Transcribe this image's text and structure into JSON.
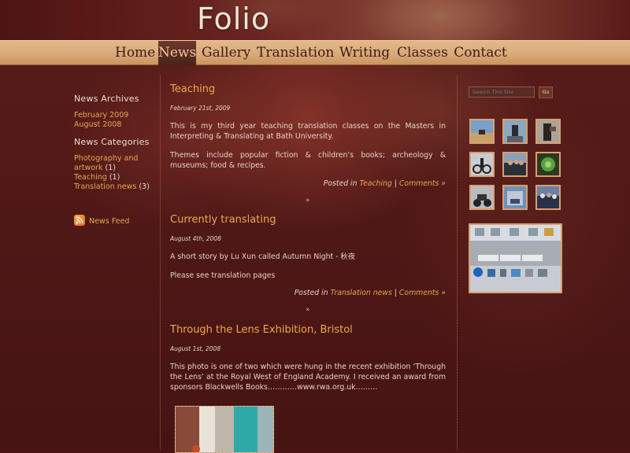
{
  "site": {
    "logo": "Folio"
  },
  "nav": {
    "items": [
      {
        "label": "Home"
      },
      {
        "label": "News"
      },
      {
        "label": "Gallery"
      },
      {
        "label": "Translation"
      },
      {
        "label": "Writing"
      },
      {
        "label": "Classes"
      },
      {
        "label": "Contact"
      }
    ],
    "active": "News"
  },
  "sidebar": {
    "archives_title": "News Archives",
    "archives": [
      "February 2009",
      "August 2008"
    ],
    "categories_title": "News Categories",
    "categories": [
      {
        "label": "Photography and",
        "label2": "artwork",
        "count": "(1)"
      },
      {
        "label": "Teaching",
        "count": "(1)"
      },
      {
        "label": "Translation news",
        "count": "(3)"
      }
    ],
    "feed_label": "News Feed"
  },
  "posts": [
    {
      "title": "Teaching",
      "date": "February 21st, 2009",
      "paragraphs": [
        "This is my third year teaching translation classes on the Masters in Interpreting & Translating at Bath University.",
        "Themes include popular fiction & children’s books; archeology & museums; food & recipes."
      ],
      "posted_in_label": "Posted in",
      "category": "Teaching",
      "divider": "|",
      "comments": "Comments »"
    },
    {
      "title": "Currently translating",
      "date": "August 4th, 2008",
      "paragraphs": [
        "A short story by Lu Xun called Autumn Night - 秋夜",
        "Please see translation pages"
      ],
      "posted_in_label": "Posted in",
      "category": "Translation news",
      "divider": "|",
      "comments": "Comments »"
    },
    {
      "title": "Through the Lens Exhibition, Bristol",
      "date": "August 1st, 2008",
      "paragraphs": [
        "This photo is one of two which were hung in the recent exhibition ‘Through the Lens’ at the Royal West of England Academy.  I received an award from sponsors Blackwells Books…………www.rwa.org.uk………"
      ]
    }
  ],
  "separator": "»",
  "search": {
    "placeholder": "Search This Site",
    "button": "Go"
  },
  "gallery": {
    "thumbs": [
      "photo-desert-camel",
      "photo-statue",
      "photo-dancer",
      "photo-cyclist",
      "photo-group",
      "photo-green-flower",
      "photo-motorbike",
      "photo-building",
      "photo-crowd"
    ]
  },
  "colors": {
    "accent": "#f2a64c",
    "link": "#e2a850",
    "nav_bg": "#d9a878",
    "page_bg": "#4a1414"
  }
}
